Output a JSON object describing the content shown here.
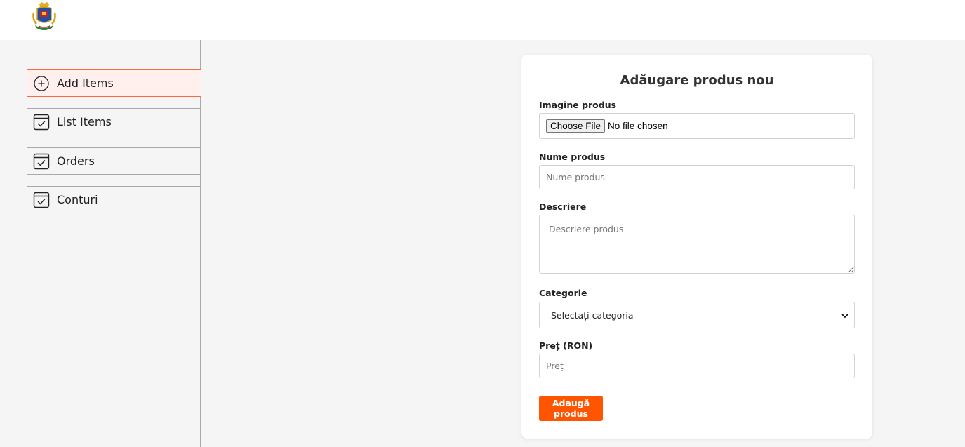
{
  "header": {
    "logo_name": "coat-of-arms-logo"
  },
  "sidebar": {
    "items": [
      {
        "label": "Add Items",
        "icon": "add-circle-icon",
        "active": true
      },
      {
        "label": "List Items",
        "icon": "checklist-icon",
        "active": false
      },
      {
        "label": "Orders",
        "icon": "checklist-icon",
        "active": false
      },
      {
        "label": "Conturi",
        "icon": "checklist-icon",
        "active": false
      }
    ]
  },
  "form": {
    "title": "Adăugare produs nou",
    "image": {
      "label": "Imagine produs",
      "button": "Choose File",
      "status": "No file chosen"
    },
    "name": {
      "label": "Nume produs",
      "placeholder": "Nume produs"
    },
    "description": {
      "label": "Descriere",
      "placeholder": "Descriere produs"
    },
    "category": {
      "label": "Categorie",
      "selected": "Selectați categoria"
    },
    "price": {
      "label": "Preț (RON)",
      "placeholder": "Preț"
    },
    "submit": "Adaugă produs"
  },
  "colors": {
    "accent": "#ff5400",
    "active_bg": "#fff0ee",
    "active_border": "#ff6a3d"
  }
}
